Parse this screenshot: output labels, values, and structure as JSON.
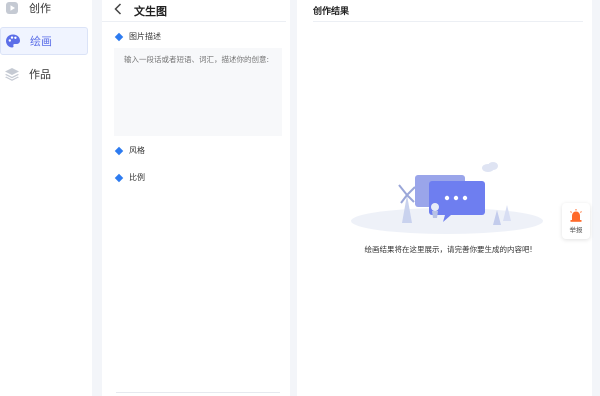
{
  "nav": {
    "items": [
      {
        "label": "创作",
        "icon": "play-icon"
      },
      {
        "label": "绘画",
        "icon": "palette-icon",
        "active": true
      },
      {
        "label": "作品",
        "icon": "layers-icon"
      }
    ]
  },
  "left_panel": {
    "back_icon": "chevron-left-icon",
    "title": "文生图",
    "image_desc_label": "图片描述",
    "image_desc_placeholder": "输入一段话或者短语、词汇，描述你的创意:",
    "style_label": "风格",
    "ratio_label": "比例"
  },
  "right_panel": {
    "title": "创作结果",
    "empty_text": "绘画结果将在这里展示，请完善你要生成的内容吧!"
  },
  "report": {
    "label": "举报",
    "icon": "alarm-icon"
  },
  "colors": {
    "accent": "#5b6ee8",
    "diamond": "#2d7bf0"
  }
}
